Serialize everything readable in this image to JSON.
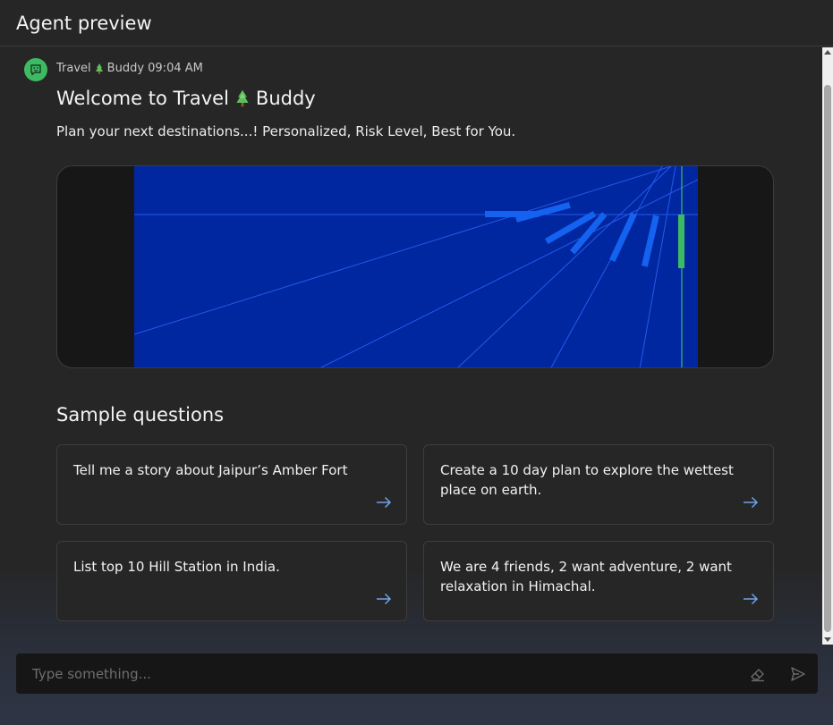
{
  "header": {
    "title": "Agent preview"
  },
  "message": {
    "meta_prefix": "Travel",
    "meta_suffix": "Buddy 09:04 AM",
    "welcome_prefix": "Welcome to Travel",
    "welcome_suffix": "Buddy",
    "subtitle": "Plan your next destinations...! Personalized, Risk Level, Best for You."
  },
  "samples": {
    "title": "Sample questions",
    "items": [
      {
        "label": "Tell me a story about Jaipur’s Amber Fort"
      },
      {
        "label": "Create a 10 day plan to explore the wettest place on earth."
      },
      {
        "label": "List top 10 Hill Station in India."
      },
      {
        "label": "We are 4 friends, 2 want adventure, 2 want relaxation in Himachal."
      }
    ]
  },
  "input": {
    "placeholder": "Type something..."
  },
  "colors": {
    "accent": "#3dbb63",
    "hero_bg": "#0027a0",
    "arrow": "#6fa3e8"
  },
  "icons": {
    "avatar": "chat-bot-icon",
    "tree": "tree-icon",
    "arrow": "arrow-right-icon",
    "clear": "eraser-icon",
    "send": "send-icon"
  }
}
